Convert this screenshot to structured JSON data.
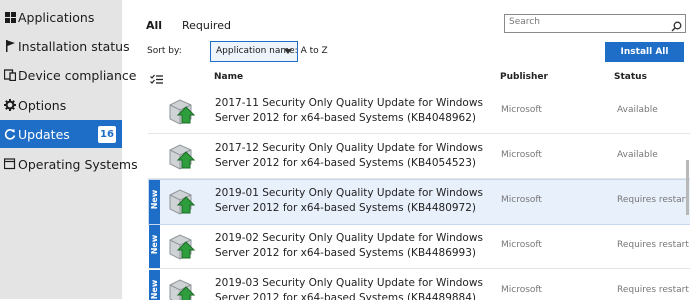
{
  "sidebar": {
    "items": [
      {
        "label": "Applications",
        "icon": "grid-icon"
      },
      {
        "label": "Installation status",
        "icon": "flag-icon"
      },
      {
        "label": "Device compliance",
        "icon": "device-icon"
      },
      {
        "label": "Options",
        "icon": "gear-icon"
      },
      {
        "label": "Updates",
        "icon": "refresh-icon",
        "badge": "16"
      },
      {
        "label": "Operating Systems",
        "icon": "os-icon"
      }
    ]
  },
  "tabs": {
    "all": "All",
    "required": "Required"
  },
  "search": {
    "placeholder": "Search"
  },
  "sort": {
    "label": "Sort by:",
    "value": "Application name: A to Z"
  },
  "install_all": "Install All",
  "columns": {
    "name": "Name",
    "publisher": "Publisher",
    "status": "Status"
  },
  "rows": [
    {
      "name": "2017-11 Security Only Quality Update for Windows Server 2012 for x64-based Systems (KB4048962)",
      "publisher": "Microsoft",
      "status": "Available",
      "new": false,
      "new_label": ""
    },
    {
      "name": "2017-12 Security Only Quality Update for Windows Server 2012 for x64-based Systems (KB4054523)",
      "publisher": "Microsoft",
      "status": "Available",
      "new": false,
      "new_label": ""
    },
    {
      "name": "2019-01 Security Only Quality Update for Windows Server 2012 for x64-based Systems (KB4480972)",
      "publisher": "Microsoft",
      "status": "Requires restart",
      "new": true,
      "new_label": "New"
    },
    {
      "name": "2019-02 Security Only Quality Update for Windows Server 2012 for x64-based Systems (KB4486993)",
      "publisher": "Microsoft",
      "status": "Requires restart",
      "new": true,
      "new_label": "New"
    },
    {
      "name": "2019-03 Security Only Quality Update for Windows Server 2012 for x64-based Systems (KB4489884)",
      "publisher": "Microsoft",
      "status": "Requires restart",
      "new": true,
      "new_label": "New"
    }
  ],
  "colors": {
    "accent": "#1e6ec8",
    "sidebar_bg": "#e4e4e4"
  }
}
